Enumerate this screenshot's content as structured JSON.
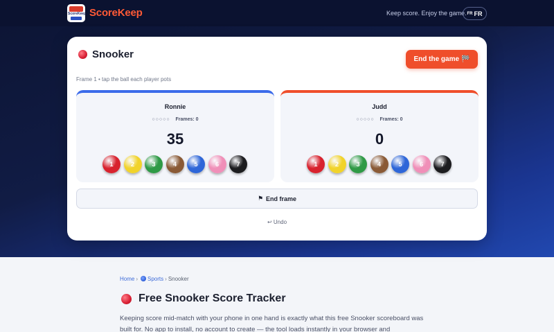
{
  "header": {
    "logo_text": "ScoreKeep",
    "brand": "ScoreKeep",
    "tagline": "Keep score. Enjoy the game.",
    "lang_flag": "FR",
    "lang_label": "FR"
  },
  "game": {
    "title": "Snooker",
    "end_game_label": "End the game",
    "end_game_icon": "🏁",
    "hint": "Frame 1 • tap the ball each player pots",
    "players": [
      {
        "name": "Ronnie",
        "dots": "○○○○○",
        "frames_label": "Frames: 0",
        "score": "35",
        "accent": "#3b6bea"
      },
      {
        "name": "Judd",
        "dots": "○○○○○",
        "frames_label": "Frames: 0",
        "score": "0",
        "accent": "#ef4e2b"
      }
    ],
    "balls": [
      {
        "value": "1",
        "color": "#d8222e"
      },
      {
        "value": "2",
        "color": "#f1d32b"
      },
      {
        "value": "3",
        "color": "#2f9a46"
      },
      {
        "value": "4",
        "color": "#8a5a36"
      },
      {
        "value": "5",
        "color": "#2e66d8"
      },
      {
        "value": "6",
        "color": "#f08fb8"
      },
      {
        "value": "7",
        "color": "#1c1c1f"
      }
    ],
    "end_frame_icon": "⚑",
    "end_frame_label": "End frame",
    "undo_label": "↩ Undo"
  },
  "content": {
    "breadcrumb": {
      "home": "Home",
      "sports": "Sports",
      "current": "Snooker"
    },
    "heading": "Free Snooker Score Tracker",
    "paragraph": "Keeping score mid-match with your phone in one hand is exactly what this free Snooker scoreboard was built for. No app to install, no account to create — the tool loads instantly in your browser and"
  }
}
